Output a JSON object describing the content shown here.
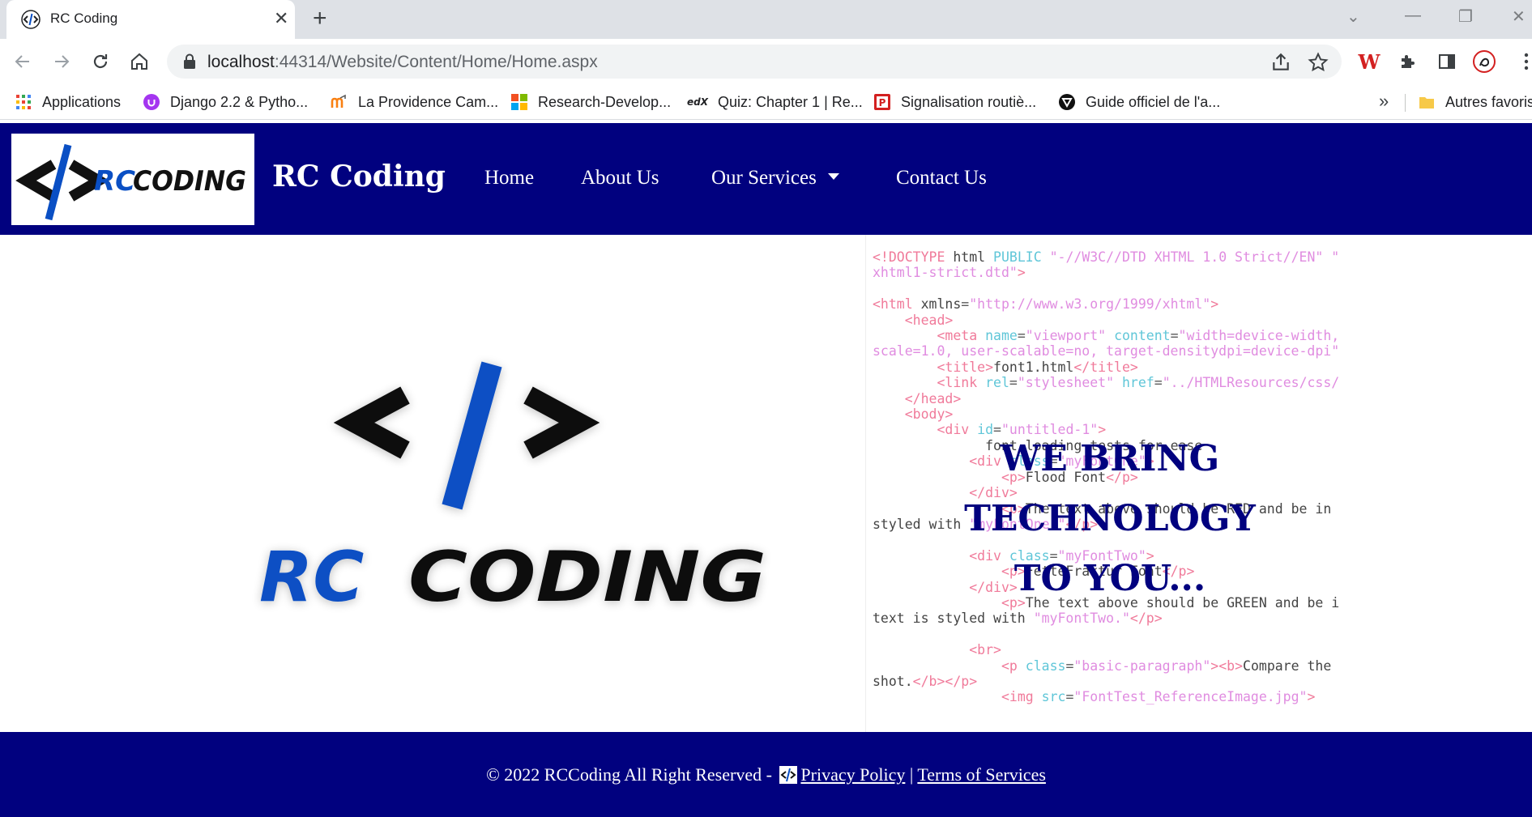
{
  "browser": {
    "tab_title": "RC Coding",
    "new_tab_label": "+",
    "close_label": "✕",
    "url_host": "localhost",
    "url_path": ":44314/Website/Content/Home/Home.aspx",
    "bookmarks": [
      {
        "label": "Applications",
        "icon": "apps-grid-icon"
      },
      {
        "label": "Django 2.2 & Pytho...",
        "icon": "udemy-icon"
      },
      {
        "label": "La Providence Cam...",
        "icon": "moodle-icon"
      },
      {
        "label": "Research-Develop...",
        "icon": "microsoft-icon"
      },
      {
        "label": "Quiz: Chapter 1 | Re...",
        "icon": "edx-icon"
      },
      {
        "label": "Signalisation routiè...",
        "icon": "p-badge-icon"
      },
      {
        "label": "Guide officiel de l'a...",
        "icon": "shield-logo-icon"
      }
    ],
    "more_bookmarks": "»",
    "other_bookmarks": "Autres favoris"
  },
  "site": {
    "brand": "RC Coding",
    "logo_text_rc": "RC",
    "logo_text_coding": "CODING",
    "nav": {
      "home": "Home",
      "about": "About Us",
      "services": "Our Services",
      "contact": "Contact Us"
    },
    "hero_line1": "WE BRING TECHNOLOGY",
    "hero_line2": "TO YOU...",
    "footer": {
      "copyright": "© 2022 RCCoding All Right Reserved -",
      "privacy": "Privacy Policy",
      "separator": "|",
      "terms": "Terms of Services"
    }
  },
  "colors": {
    "brand_navy": "#01017f",
    "logo_blue": "#0a4fc4"
  }
}
